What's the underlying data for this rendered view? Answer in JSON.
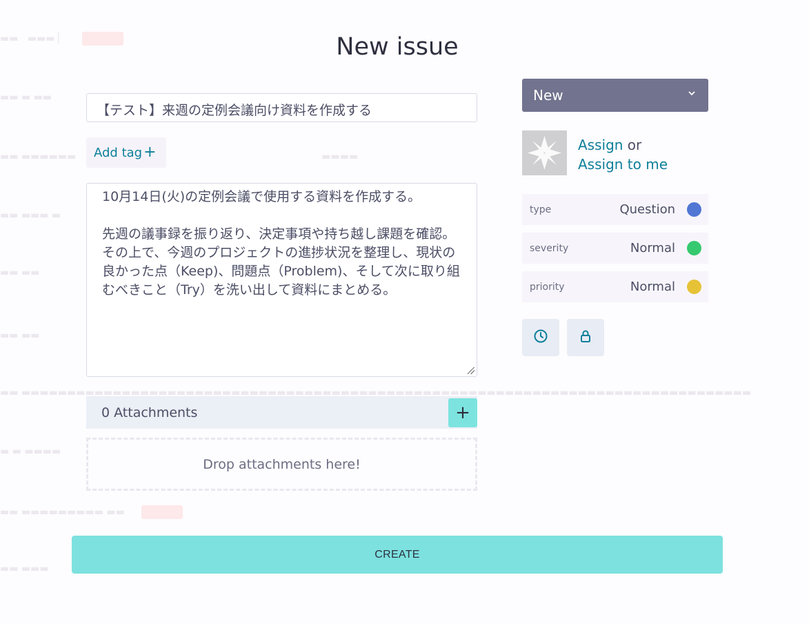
{
  "dialog": {
    "title": "New issue",
    "subject": "【テスト】来週の定例会議向け資料を作成する",
    "add_tag_label": "Add tag",
    "description": "10月14日(火)の定例会議で使用する資料を作成する。\n\n先週の議事録を振り返り、決定事項や持ち越し課題を確認。\nその上で、今週のプロジェクトの進捗状況を整理し、現状の良かった点（Keep)、問題点（Problem)、そして次に取り組むべきこと（Try）を洗い出して資料にまとめる。",
    "attachments": {
      "header": "0 Attachments",
      "add_icon": "plus-icon",
      "drop_text": "Drop attachments here!"
    },
    "create_label": "CREATE"
  },
  "sidebar": {
    "status": "New",
    "assign_label": "Assign",
    "or_text": " or",
    "assign_me_label": "Assign to me",
    "attributes": [
      {
        "label": "type",
        "value": "Question",
        "color": "#5176d4"
      },
      {
        "label": "severity",
        "value": "Normal",
        "color": "#36c96f"
      },
      {
        "label": "priority",
        "value": "Normal",
        "color": "#e6c236"
      }
    ],
    "buttons": [
      {
        "icon": "clock-icon"
      },
      {
        "icon": "lock-icon"
      }
    ]
  },
  "colors": {
    "accent": "#7de1df",
    "link": "#0d7f99",
    "status_bg": "#72738f"
  }
}
